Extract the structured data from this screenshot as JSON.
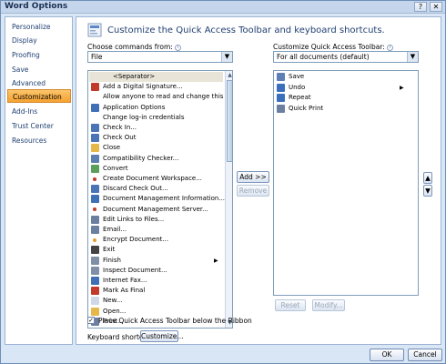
{
  "window": {
    "title": "Word Options",
    "help_glyph": "?",
    "close_glyph": "✕"
  },
  "sidebar": {
    "items": [
      {
        "label": "Personalize"
      },
      {
        "label": "Display"
      },
      {
        "label": "Proofing"
      },
      {
        "label": "Save"
      },
      {
        "label": "Advanced"
      },
      {
        "label": "Customization",
        "active": true
      },
      {
        "label": "Add-Ins"
      },
      {
        "label": "Trust Center"
      },
      {
        "label": "Resources"
      }
    ]
  },
  "main": {
    "header": "Customize the Quick Access Toolbar and keyboard shortcuts.",
    "choose_label": "Choose commands from:",
    "choose_value": "File",
    "customize_label": "Customize Quick Access Toolbar:",
    "customize_value": "For all documents (default)",
    "commands": [
      {
        "label": "<Separator>",
        "icon": "separator-icon",
        "selected": true
      },
      {
        "label": "Add a Digital Signature...",
        "icon": "signature-icon"
      },
      {
        "label": "Allow anyone to read and change this docu...",
        "icon": ""
      },
      {
        "label": "Application Options",
        "icon": "options-icon"
      },
      {
        "label": "Change log-in credentials",
        "icon": ""
      },
      {
        "label": "Check In...",
        "icon": "check-in-icon"
      },
      {
        "label": "Check Out",
        "icon": "check-out-icon"
      },
      {
        "label": "Close",
        "icon": "folder-close-icon"
      },
      {
        "label": "Compatibility Checker...",
        "icon": "compatibility-icon"
      },
      {
        "label": "Convert",
        "icon": "convert-icon"
      },
      {
        "label": "Create Document Workspace...",
        "icon": "workspace-icon"
      },
      {
        "label": "Discard Check Out...",
        "icon": "discard-icon"
      },
      {
        "label": "Document Management Information...",
        "icon": "doc-info-icon"
      },
      {
        "label": "Document Management Server...",
        "icon": "server-icon"
      },
      {
        "label": "Edit Links to Files...",
        "icon": "links-icon"
      },
      {
        "label": "Email...",
        "icon": "email-icon"
      },
      {
        "label": "Encrypt Document...",
        "icon": "encrypt-icon"
      },
      {
        "label": "Exit",
        "icon": "exit-icon"
      },
      {
        "label": "Finish",
        "icon": "finish-icon",
        "submenu": true
      },
      {
        "label": "Inspect Document...",
        "icon": "inspect-icon"
      },
      {
        "label": "Internet Fax...",
        "icon": "fax-icon"
      },
      {
        "label": "Mark As Final",
        "icon": "mark-final-icon"
      },
      {
        "label": "New...",
        "icon": "new-icon"
      },
      {
        "label": "Open...",
        "icon": "open-icon"
      },
      {
        "label": "Print...",
        "icon": "print-icon"
      }
    ],
    "toolbar_items": [
      {
        "label": "Save",
        "icon": "save-icon"
      },
      {
        "label": "Undo",
        "icon": "undo-icon",
        "submenu": true
      },
      {
        "label": "Repeat",
        "icon": "repeat-icon"
      },
      {
        "label": "Quick Print",
        "icon": "print-icon"
      }
    ],
    "add_button": "Add >>",
    "remove_button": "Remove",
    "reset_button": "Reset",
    "modify_button": "Modify...",
    "move_up_glyph": "▲",
    "move_down_glyph": "▼",
    "place_below_checked": true,
    "place_below_label": "Place Quick Access Toolbar below the Ribbon",
    "keyboard_label": "Keyboard shortcuts:",
    "customize_button": "Customize..."
  },
  "footer": {
    "ok": "OK",
    "cancel": "Cancel"
  }
}
